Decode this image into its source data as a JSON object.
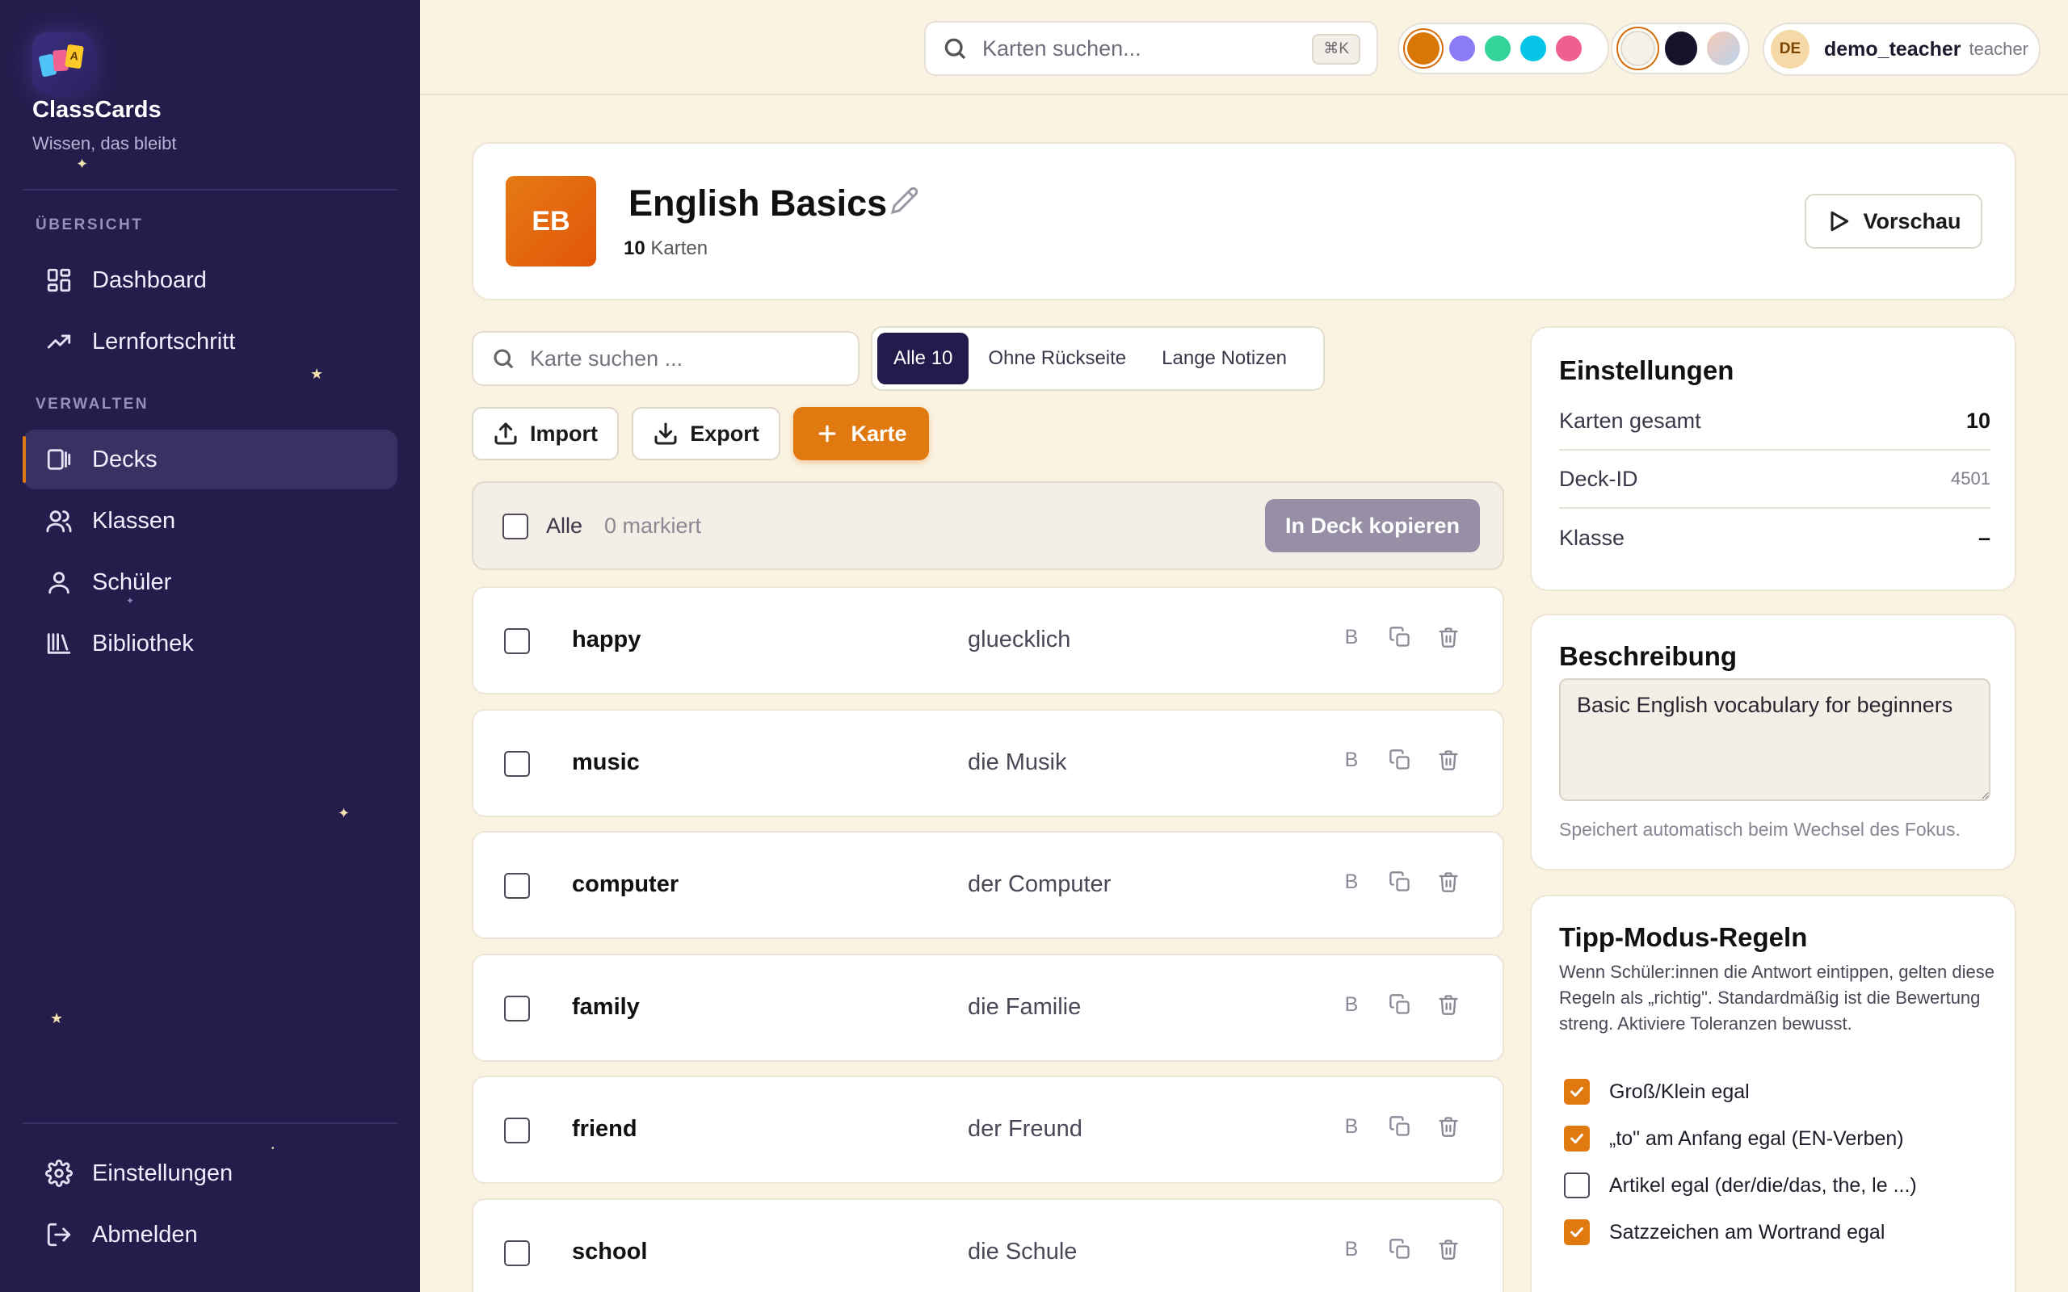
{
  "app": {
    "name": "ClassCards",
    "tagline": "Wissen, das bleibt",
    "logo_letter": "A"
  },
  "sidebar": {
    "section_overview": "ÜBERSICHT",
    "section_manage": "VERWALTEN",
    "items": [
      {
        "label": "Dashboard",
        "icon": "grid-icon"
      },
      {
        "label": "Lernfortschritt",
        "icon": "trending-up-icon"
      },
      {
        "label": "Decks",
        "icon": "deck-icon",
        "active": true
      },
      {
        "label": "Klassen",
        "icon": "users-icon"
      },
      {
        "label": "Schüler",
        "icon": "user-icon"
      },
      {
        "label": "Bibliothek",
        "icon": "library-icon"
      }
    ],
    "footer": [
      {
        "label": "Einstellungen",
        "icon": "gear-icon"
      },
      {
        "label": "Abmelden",
        "icon": "logout-icon"
      }
    ]
  },
  "topbar": {
    "search_placeholder": "Karten suchen...",
    "search_shortcut": "⌘K",
    "accent_colors": [
      "#d97706",
      "#8b7cf6",
      "#34d399",
      "#06c5e6",
      "#f0608f"
    ],
    "theme_options": [
      "#f6f1e6",
      "#16142b",
      "#e9d6dc"
    ],
    "user": {
      "initials": "DE",
      "name": "demo_teacher",
      "role": "teacher"
    }
  },
  "deck": {
    "badge": "EB",
    "title": "English Basics",
    "count": "10",
    "count_label": "Karten",
    "preview_label": "Vorschau"
  },
  "toolbar": {
    "search_placeholder": "Karte suchen ...",
    "filters": [
      "Alle 10",
      "Ohne Rückseite",
      "Lange Notizen"
    ],
    "import_label": "Import",
    "export_label": "Export",
    "add_label": "Karte"
  },
  "selection": {
    "all_label": "Alle",
    "marked_label": "0 markiert",
    "copy_label": "In Deck kopieren"
  },
  "cards": [
    {
      "front": "happy",
      "back": "gluecklich",
      "bold_icon": "B"
    },
    {
      "front": "music",
      "back": "die Musik",
      "bold_icon": "B"
    },
    {
      "front": "computer",
      "back": "der Computer",
      "bold_icon": "B"
    },
    {
      "front": "family",
      "back": "die Familie",
      "bold_icon": "B"
    },
    {
      "front": "friend",
      "back": "der Freund",
      "bold_icon": "B"
    },
    {
      "front": "school",
      "back": "die Schule",
      "bold_icon": "B"
    }
  ],
  "settings": {
    "title": "Einstellungen",
    "rows": [
      {
        "key": "Karten gesamt",
        "value": "10"
      },
      {
        "key": "Deck-ID",
        "value": "4501"
      },
      {
        "key": "Klasse",
        "value": "–"
      }
    ]
  },
  "description": {
    "title": "Beschreibung",
    "value": "Basic English vocabulary for beginners",
    "hint": "Speichert automatisch beim Wechsel des Fokus."
  },
  "typing_rules": {
    "title": "Tipp-Modus-Regeln",
    "text": "Wenn Schüler:innen die Antwort eintippen, gelten diese Regeln als „richtig\". Standardmäßig ist die Bewertung streng. Aktiviere Toleranzen bewusst.",
    "rules": [
      {
        "label": "Groß/Klein egal",
        "checked": true
      },
      {
        "label": "„to\" am Anfang egal (EN-Verben)",
        "checked": true
      },
      {
        "label": "Artikel egal (der/die/das, the, le ...)",
        "checked": false
      },
      {
        "label": "Satzzeichen am Wortrand egal",
        "checked": true
      }
    ]
  }
}
